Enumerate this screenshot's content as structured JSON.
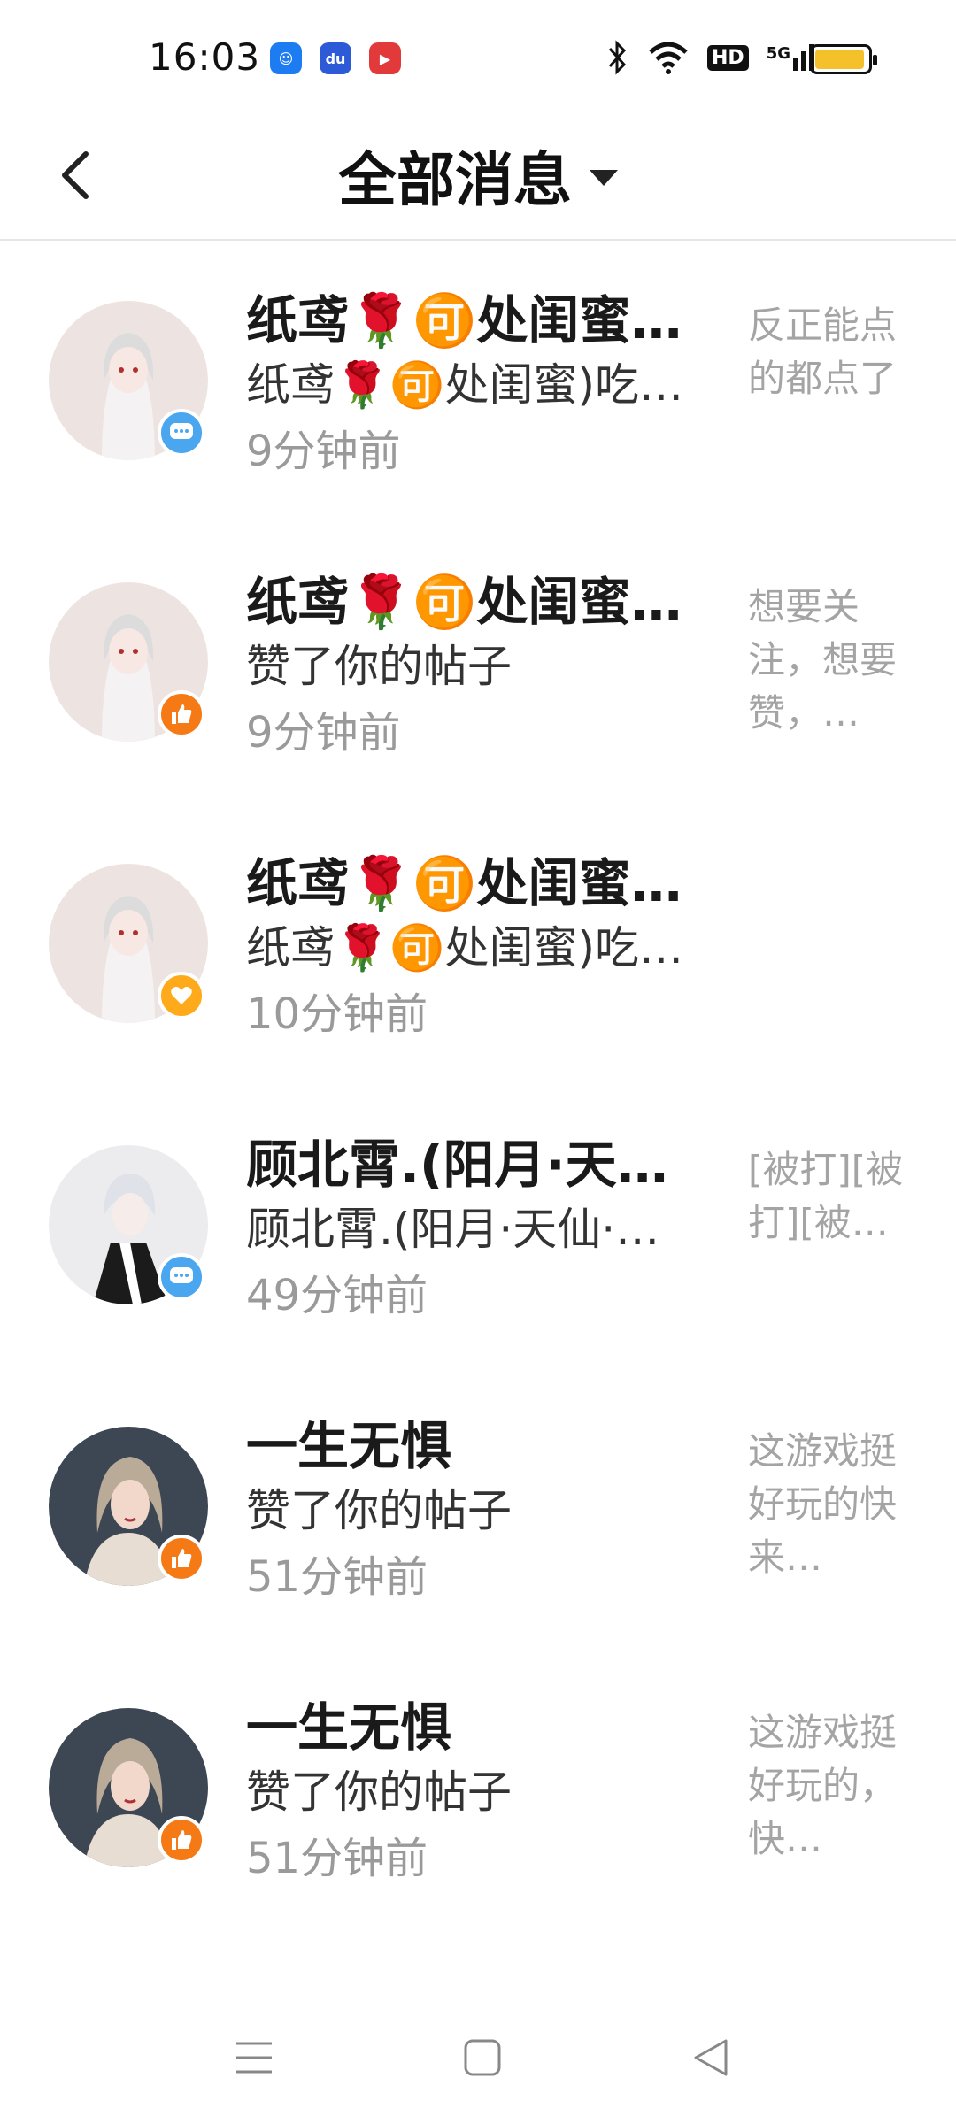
{
  "status_bar": {
    "time": "16:03",
    "icons": [
      "notification-app-icon",
      "baidu-app-icon",
      "video-app-icon",
      "bluetooth-icon",
      "wifi-icon",
      "hd-icon",
      "signal-5g-icon",
      "battery-icon"
    ],
    "hd": "HD",
    "network": "5G"
  },
  "header": {
    "title": "全部消息",
    "back_icon": "chevron-left-icon",
    "dropdown_icon": "triangle-down-icon"
  },
  "messages": [
    {
      "name": "纸鸢🌹🉑处闺蜜…",
      "content": "纸鸢🌹🉑处闺蜜)吃…",
      "time": "9分钟前",
      "preview": "反正能点的都点了",
      "badge": "comment-icon"
    },
    {
      "name": "纸鸢🌹🉑处闺蜜…",
      "content": "赞了你的帖子",
      "time": "9分钟前",
      "preview": "想要关注，想要赞，…",
      "badge": "thumbs-up-icon"
    },
    {
      "name": "纸鸢🌹🉑处闺蜜…",
      "content": "纸鸢🌹🉑处闺蜜)吃…",
      "time": "10分钟前",
      "preview": "",
      "badge": "heart-icon"
    },
    {
      "name": "顾北霄.(阳月·天…",
      "content": "顾北霄.(阳月·天仙·…",
      "time": "49分钟前",
      "preview": "[被打][被打][被…",
      "badge": "comment-icon"
    },
    {
      "name": "一生无惧",
      "content": "赞了你的帖子",
      "time": "51分钟前",
      "preview": "这游戏挺好玩的快来…",
      "badge": "thumbs-up-icon"
    },
    {
      "name": "一生无惧",
      "content": "赞了你的帖子",
      "time": "51分钟前",
      "preview": "这游戏挺好玩的，快…",
      "badge": "thumbs-up-icon"
    }
  ],
  "nav": {
    "menu_icon": "menu-icon",
    "home_icon": "square-home-icon",
    "back_icon": "triangle-back-icon"
  }
}
